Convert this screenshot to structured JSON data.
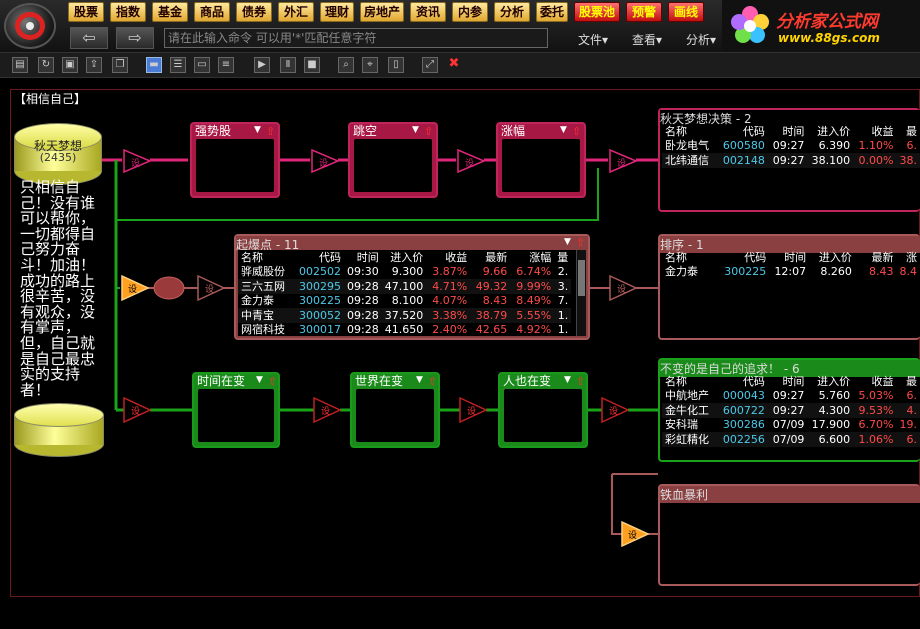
{
  "menu": {
    "items": [
      {
        "label": "股票",
        "red": false
      },
      {
        "label": "指数",
        "red": false
      },
      {
        "label": "基金",
        "red": false
      },
      {
        "label": "商品",
        "red": false
      },
      {
        "label": "债券",
        "red": false
      },
      {
        "label": "外汇",
        "red": false
      },
      {
        "label": "理财",
        "red": false
      },
      {
        "label": "房地产",
        "red": false
      },
      {
        "label": "资讯",
        "red": false
      },
      {
        "label": "内参",
        "red": false
      },
      {
        "label": "分析",
        "red": false
      },
      {
        "label": "委托",
        "red": false
      },
      {
        "label": "股票池",
        "red": true
      },
      {
        "label": "预警",
        "red": true
      },
      {
        "label": "画线",
        "red": true
      }
    ]
  },
  "nav": {
    "command_placeholder": "请在此输入命令   可以用'*'匹配任意字符",
    "file_menu": "文件▾",
    "view_menu": "查看▾",
    "analysis_menu": "分析▾"
  },
  "brand": {
    "title": "分析家公式网",
    "url": "www.88gs.com"
  },
  "workspace": {
    "title": "【相信自己】"
  },
  "source": {
    "name": "秋天梦想",
    "count": "(2435)"
  },
  "motto": "只相信自己！没有谁可以帮你，一切都得自己努力奋斗！加油！成功的路上很辛苦，没有观众，没有掌声，但，自己就是自己最忠实的支持者！",
  "node_label": "设",
  "filters": {
    "row1": [
      "强势股",
      "跳空",
      "涨幅"
    ],
    "row3": [
      "时间在变",
      "世界在变",
      "人也在变"
    ]
  },
  "colors": {
    "pink": "#e0267a",
    "green": "#1aa21a",
    "brown": "#a85a5a",
    "arrow": "#ff2020"
  },
  "panels": {
    "p1": {
      "title": "秋天梦想决策 - 2",
      "headers": [
        "名称",
        "代码",
        "时间",
        "进入价",
        "收益",
        "最"
      ],
      "rows": [
        [
          "卧龙电气",
          "600580",
          "09:27",
          "6.390",
          "1.10%",
          "6."
        ],
        [
          "北纬通信",
          "002148",
          "09:27",
          "38.100",
          "0.00%",
          "38."
        ]
      ]
    },
    "p2": {
      "title": "起爆点 - 11",
      "headers": [
        "名称",
        "代码",
        "时间",
        "进入价",
        "收益",
        "最新",
        "涨幅",
        "量"
      ],
      "rows": [
        [
          "骅威股份",
          "002502",
          "09:30",
          "9.300",
          "3.87%",
          "9.66",
          "6.74%",
          "2."
        ],
        [
          "三六五网",
          "300295",
          "09:28",
          "47.100",
          "4.71%",
          "49.32",
          "9.99%",
          "3."
        ],
        [
          "金力泰",
          "300225",
          "09:28",
          "8.100",
          "4.07%",
          "8.43",
          "8.49%",
          "7."
        ],
        [
          "中青宝",
          "300052",
          "09:28",
          "37.520",
          "3.38%",
          "38.79",
          "5.55%",
          "1."
        ],
        [
          "网宿科技",
          "300017",
          "09:28",
          "41.650",
          "2.40%",
          "42.65",
          "4.92%",
          "1."
        ]
      ],
      "scroll": 0.2
    },
    "p3": {
      "title": "排序 - 1",
      "headers": [
        "名称",
        "代码",
        "时间",
        "进入价",
        "最新",
        "涨"
      ],
      "rows": [
        [
          "金力泰",
          "300225",
          "12:07",
          "8.260",
          "8.43",
          "8.4"
        ]
      ]
    },
    "p4": {
      "title": "不变的是自己的追求！ - 6",
      "headers": [
        "名称",
        "代码",
        "时间",
        "进入价",
        "收益",
        "最"
      ],
      "rows": [
        [
          "中航地产",
          "000043",
          "09:27",
          "5.760",
          "5.03%",
          "6."
        ],
        [
          "金牛化工",
          "600722",
          "09:27",
          "4.300",
          "9.53%",
          "4."
        ],
        [
          "安科瑞",
          "300286",
          "07/09",
          "17.900",
          "6.70%",
          "19."
        ],
        [
          "彩虹精化",
          "002256",
          "07/09",
          "6.600",
          "1.06%",
          "6."
        ]
      ]
    },
    "p5": {
      "title": "铁血暴利",
      "headers": [],
      "rows": []
    }
  }
}
